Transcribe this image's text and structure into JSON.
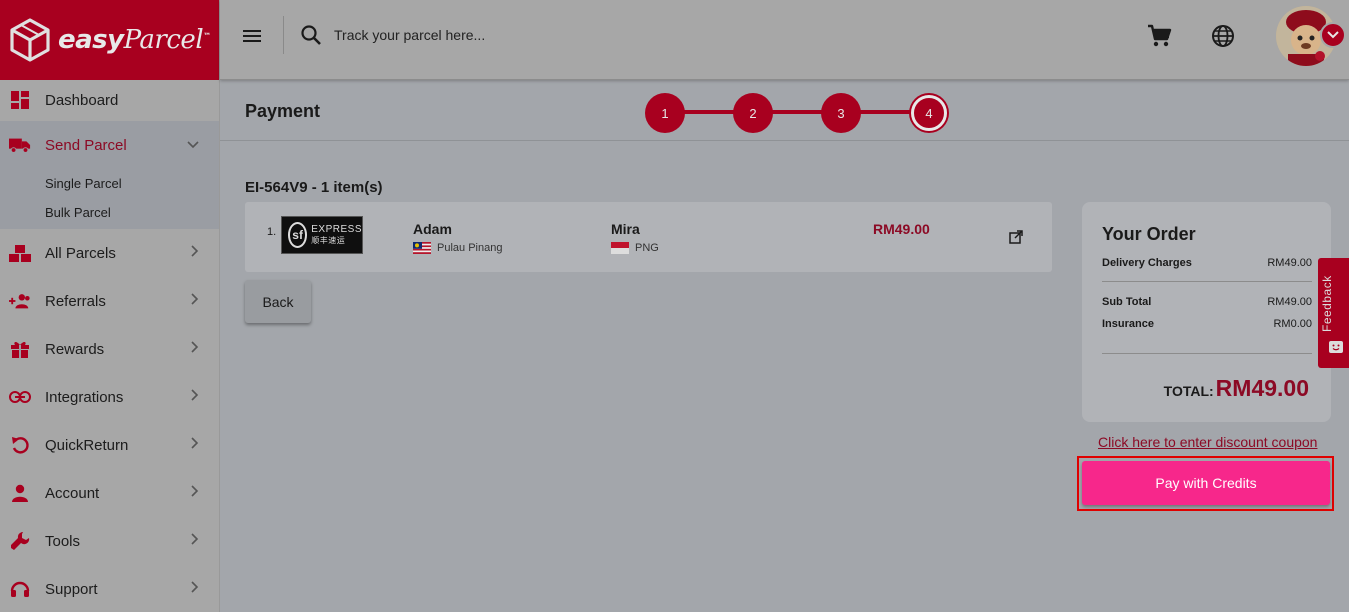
{
  "brand": {
    "name_a": "easy",
    "name_b": "Parcel",
    "tm": "™",
    "accent": "#a8001f",
    "pink": "#f7278b"
  },
  "search": {
    "placeholder": "Track your parcel here..."
  },
  "sidebar": {
    "items": [
      {
        "label": "Dashboard",
        "icon": "dashboard-icon"
      },
      {
        "label": "Send Parcel",
        "icon": "truck-icon",
        "expanded": true,
        "children": [
          {
            "label": "Single Parcel"
          },
          {
            "label": "Bulk Parcel"
          }
        ]
      },
      {
        "label": "All Parcels",
        "icon": "boxes-icon"
      },
      {
        "label": "Referrals",
        "icon": "referrals-icon"
      },
      {
        "label": "Rewards",
        "icon": "gift-icon"
      },
      {
        "label": "Integrations",
        "icon": "link-icon"
      },
      {
        "label": "QuickReturn",
        "icon": "return-icon"
      },
      {
        "label": "Account",
        "icon": "person-icon"
      },
      {
        "label": "Tools",
        "icon": "wrench-icon"
      },
      {
        "label": "Support",
        "icon": "headset-icon"
      }
    ]
  },
  "page": {
    "title": "Payment",
    "steps": [
      "1",
      "2",
      "3",
      "4"
    ],
    "active_step": 4
  },
  "order": {
    "id_label": "EI-564V9 - 1 item(s)",
    "parcel": {
      "index": "1.",
      "courier_logo_text": "EXPRESS",
      "courier_logo_sub": "顺丰速运",
      "courier_logo_mark": "sf",
      "sender_name": "Adam",
      "sender_location": "Pulau Pinang",
      "receiver_name": "Mira",
      "receiver_location": "PNG",
      "price": "RM49.00"
    },
    "back_label": "Back"
  },
  "summary": {
    "title": "Your Order",
    "delivery_label": "Delivery Charges",
    "delivery_value": "RM49.00",
    "subtotal_label": "Sub Total",
    "subtotal_value": "RM49.00",
    "insurance_label": "Insurance",
    "insurance_value": "RM0.00",
    "total_label": "TOTAL:",
    "total_value": "RM49.00"
  },
  "discount_link": "Click here to enter discount coupon",
  "pay_button": "Pay with Credits",
  "feedback_label": "Feedback"
}
